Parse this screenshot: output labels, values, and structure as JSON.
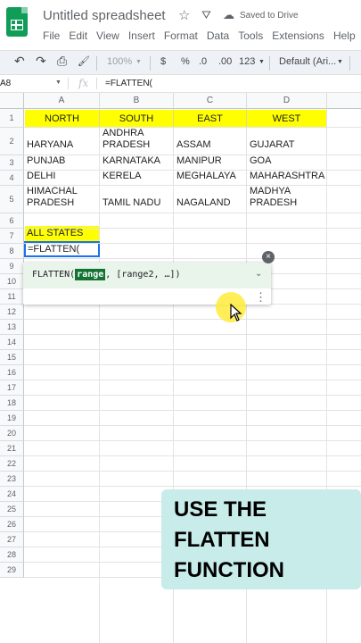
{
  "header": {
    "title": "Untitled spreadsheet",
    "saved_status": "Saved to Drive",
    "star_icon": "☆",
    "drive_icon": "⛛",
    "cloud_icon": "☁",
    "menu": [
      "File",
      "Edit",
      "View",
      "Insert",
      "Format",
      "Data",
      "Tools",
      "Extensions",
      "Help"
    ]
  },
  "toolbar": {
    "zoom": "100%",
    "currency": "$",
    "percent": "%",
    "decrease_decimal": ".0",
    "increase_decimal": ".00",
    "more_formats": "123",
    "font": "Default (Ari...",
    "undo_icon": "↶",
    "redo_icon": "↷",
    "print_icon": "⎙",
    "paint_icon": "🖌"
  },
  "formula_bar": {
    "cell_ref": "A8",
    "fx": "fx",
    "formula": "=FLATTEN("
  },
  "sheet": {
    "columns": [
      "A",
      "B",
      "C",
      "D"
    ],
    "rows": [
      "1",
      "2",
      "3",
      "4",
      "5",
      "6",
      "7",
      "8",
      "9",
      "10",
      "11",
      "12",
      "13",
      "14",
      "15",
      "16",
      "17",
      "18",
      "19",
      "20",
      "21",
      "22",
      "23",
      "24",
      "25",
      "26",
      "27",
      "28",
      "29"
    ],
    "headers": [
      "NORTH",
      "SOUTH",
      "EAST",
      "WEST"
    ],
    "data": [
      [
        "HARYANA",
        "ANDHRA PRADESH",
        "ASSAM",
        "GUJARAT"
      ],
      [
        "PUNJAB",
        "KARNATAKA",
        "MANIPUR",
        "GOA"
      ],
      [
        "DELHI",
        "KERELA",
        "MEGHALAYA",
        "MAHARASHTRA"
      ],
      [
        "HIMACHAL PRADESH",
        "TAMIL NADU",
        "NAGALAND",
        "MADHYA PRADESH"
      ]
    ],
    "all_states_label": "ALL STATES",
    "active_input": "=FLATTEN("
  },
  "tooltip": {
    "fn_name": "FLATTEN(",
    "arg_highlight": "range",
    "rest": ", [range2, …])",
    "close": "×",
    "chevron": "⌄",
    "more": "⋮"
  },
  "caption": {
    "text": "USE THE\nFLATTEN\nFUNCTION"
  },
  "colors": {
    "header_fill": "#ffff00",
    "accent": "#1a73e8",
    "caption_bg": "#c7ecea"
  }
}
